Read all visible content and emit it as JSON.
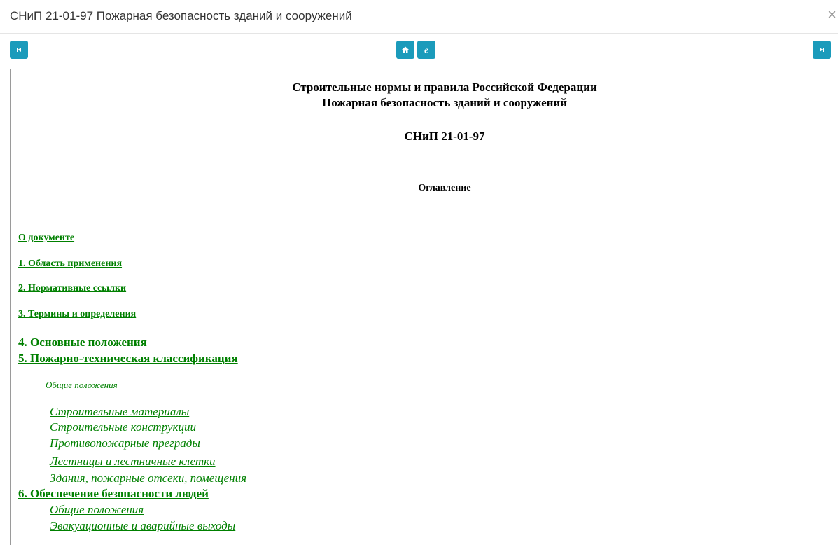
{
  "window": {
    "title": "СНиП 21-01-97 Пожарная безопасность зданий и сооружений",
    "close_glyph": "×"
  },
  "toolbar": {
    "first_icon": "skip-to-start-icon",
    "home_icon": "home-icon",
    "browser_icon": "internet-explorer-icon",
    "last_icon": "skip-to-end-icon",
    "accent_color": "#1b9bbb"
  },
  "document": {
    "heading_line1": "Строительные нормы и правила Российской Федерации",
    "heading_line2": "Пожарная безопасность зданий и сооружений",
    "code": "СНиП 21-01-97",
    "toc_title": "Оглавление",
    "link_color": "#008000",
    "toc": [
      "О документе",
      "1. Область применения",
      "2. Нормативные ссылки",
      "3. Термины и определения",
      "4. Основные положения",
      "5. Пожарно-техническая классификация",
      "Общие положения",
      "Строительные материалы",
      "Строительные конструкции",
      "Противопожарные преграды",
      "Лестницы и лестничные клетки",
      "Здания, пожарные отсеки, помещения",
      "6. Обеспечение безопасности людей",
      "Общие положения",
      "Эвакуационные и аварийные выходы"
    ]
  }
}
